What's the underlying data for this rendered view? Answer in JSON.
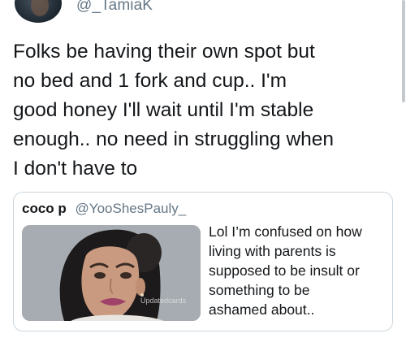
{
  "tweet": {
    "author_handle": "@_TamiaK",
    "text": "Folks be having their own spot but\nno bed and 1 fork and cup.. I'm\ngood honey I'll wait until I'm stable\nenough.. no need in struggling when\nI don't have to"
  },
  "quoted_tweet": {
    "author_name": "coco p",
    "author_handle": "@YooShesPauly_",
    "text": "Lol I’m confused on how\nliving with parents is\nsupposed to be insult or\nsomething to be\nashamed about..",
    "media": {
      "alt": "woman crying",
      "watermark": "Updatedcards"
    }
  },
  "colors": {
    "text_primary": "#14171a",
    "text_secondary": "#657786",
    "card_border": "#ccd6dd"
  }
}
